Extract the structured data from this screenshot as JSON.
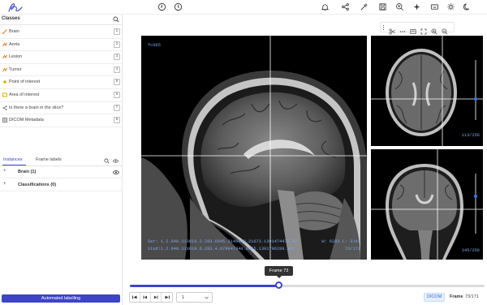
{
  "colors": {
    "accent": "#3d44c7",
    "overlay_text": "#7ea7e6",
    "crosshair": "#ffffff",
    "slider_gray": "#cfcfcf"
  },
  "topbar": {
    "logo": "ai-signature-logo",
    "left_icons": [
      "clock-back-icon",
      "clock-forward-icon"
    ],
    "right_icons": [
      "bell-icon",
      "share-icon",
      "pipette-icon",
      "save-icon",
      "zoom-in-icon",
      "sparkle-icon",
      "keyboard-icon",
      "settings-icon",
      "moon-icon"
    ]
  },
  "classes_panel": {
    "title": "Classes",
    "items": [
      {
        "label": "Brain",
        "key": "1",
        "icon": "line-icon",
        "color": "#e07b1a"
      },
      {
        "label": "Aorta",
        "key": "2",
        "icon": "polyline-icon",
        "color": "#e07b1a"
      },
      {
        "label": "Lesion",
        "key": "3",
        "icon": "polyline-icon",
        "color": "#e07b1a"
      },
      {
        "label": "Tumor",
        "key": "4",
        "icon": "polyline-icon",
        "color": "#e07b1a"
      },
      {
        "label": "Point of interest",
        "key": "5",
        "icon": "point-icon",
        "color": "#d4b400"
      },
      {
        "label": "Area of interest",
        "key": "6",
        "icon": "box-icon",
        "color": "#d4b400"
      },
      {
        "label": "Is there a brain in the slice?",
        "key": "7",
        "icon": "share-icon",
        "color": "#555555"
      },
      {
        "label": "DICOM Metadata",
        "key": "8",
        "icon": "grid-icon",
        "color": "#555555"
      }
    ]
  },
  "instances_panel": {
    "tabs": [
      "Instances",
      "Frame labels"
    ],
    "active_tab": "Instances",
    "rows": [
      {
        "label": "Brain (1)",
        "has_eye": true
      },
      {
        "label": "Classifications (0)",
        "has_eye": false
      }
    ]
  },
  "automated_labelling_button": "Automated labelling",
  "viewer": {
    "toolbar_icons": [
      "drag-handle-icon",
      "scissors-icon",
      "dots-icon",
      "layout-icon",
      "fullscreen-icon",
      "zoom-in-icon",
      "zoom-out-icon"
    ],
    "main_view": {
      "label": "fc065",
      "series_line": "Ser: 1.2.840.113619.2.283.6945.3146400.21673.1391474473.97",
      "study_line": "Stud:1.2.840.113619.6.283.4.679947340.8065.1391796289.307",
      "window_level": "W: 6283 L: 3141",
      "slice": "73/171"
    },
    "axial_view": {
      "slice": "113/256"
    },
    "coronal_view": {
      "slice": "145/256"
    }
  },
  "timeline": {
    "tooltip": "Frame 73",
    "frame_fraction": 0.42,
    "nav_buttons": [
      "first-frame-icon",
      "prev-frame-icon",
      "next-frame-icon",
      "last-frame-icon"
    ],
    "select_value": "1",
    "badge": "DICOM",
    "frame_label": "Frame",
    "frame_value": "73/171"
  }
}
